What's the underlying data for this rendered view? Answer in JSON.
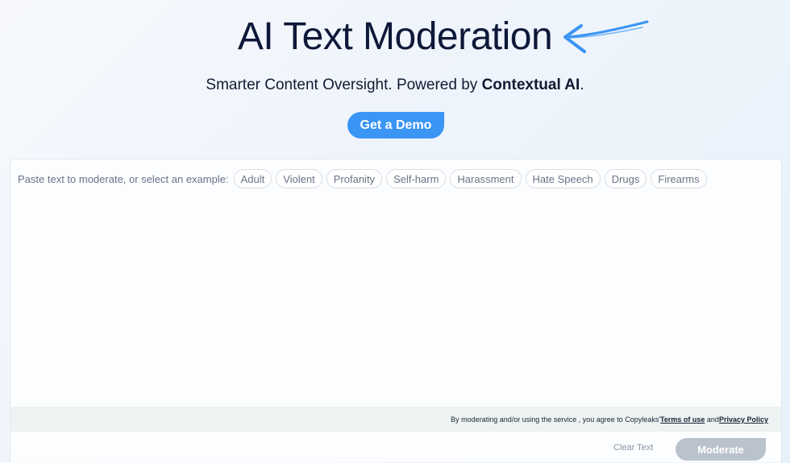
{
  "hero": {
    "title": "AI Text Moderation",
    "subtitle_prefix": "Smarter Content Oversight. Powered by ",
    "subtitle_brand": "Contextual AI",
    "subtitle_suffix": ".",
    "demo_label": "Get a Demo",
    "accent_color": "#3b95f5",
    "arrow_icon": "hand-drawn-arrow-left-icon"
  },
  "moderation": {
    "prompt_label": "Paste text to moderate, or select an example:",
    "examples": [
      "Adult",
      "Violent",
      "Profanity",
      "Self-harm",
      "Harassment",
      "Hate Speech",
      "Drugs",
      "Firearms"
    ],
    "text_value": "",
    "consent_prefix": "By moderating and/or using the service , you agree to Copyleaks' ",
    "terms_label": "Terms of use ",
    "consent_and": "and ",
    "privacy_label": "Privacy Policy",
    "clear_label": "Clear Text",
    "moderate_label": "Moderate"
  }
}
